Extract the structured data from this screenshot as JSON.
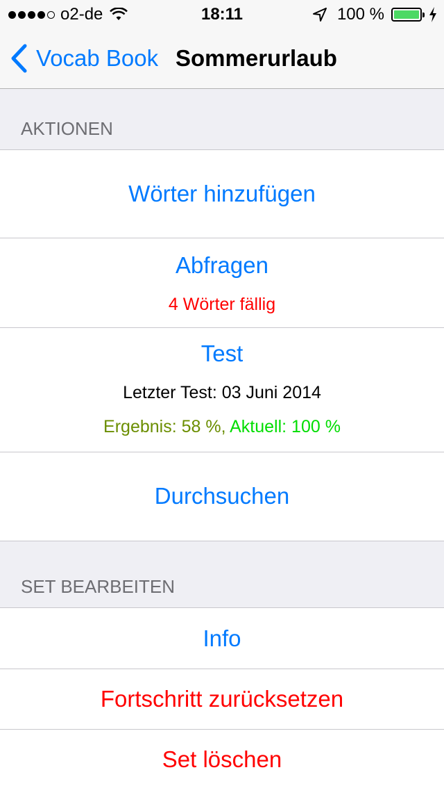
{
  "status_bar": {
    "carrier": "o2-de",
    "time": "18:11",
    "battery_percent": "100 %",
    "battery_level": 1.0,
    "signal_bars_filled": 4,
    "signal_bars_total": 5,
    "icons": [
      "wifi-icon",
      "location-icon",
      "battery-icon",
      "charging-icon"
    ]
  },
  "nav": {
    "back_label": "Vocab Book",
    "title": "Sommerurlaub"
  },
  "sections": {
    "actions_header": "AKTIONEN",
    "edit_header": "SET BEARBEITEN"
  },
  "rows": {
    "add_words": "Wörter hinzufügen",
    "query": "Abfragen",
    "query_due": "4 Wörter fällig",
    "test": "Test",
    "last_test": "Letzter Test: 03 Juni 2014",
    "result": "Ergebnis: 58 %,",
    "current": "Aktuell: 100 %",
    "browse": "Durchsuchen",
    "info": "Info",
    "reset_progress": "Fortschritt zurücksetzen",
    "delete_set": "Set löschen"
  },
  "colors": {
    "accent": "#007aff",
    "destructive": "#ff0000",
    "result": "#6b8e00",
    "current": "#00dd00",
    "battery": "#4cd964"
  }
}
